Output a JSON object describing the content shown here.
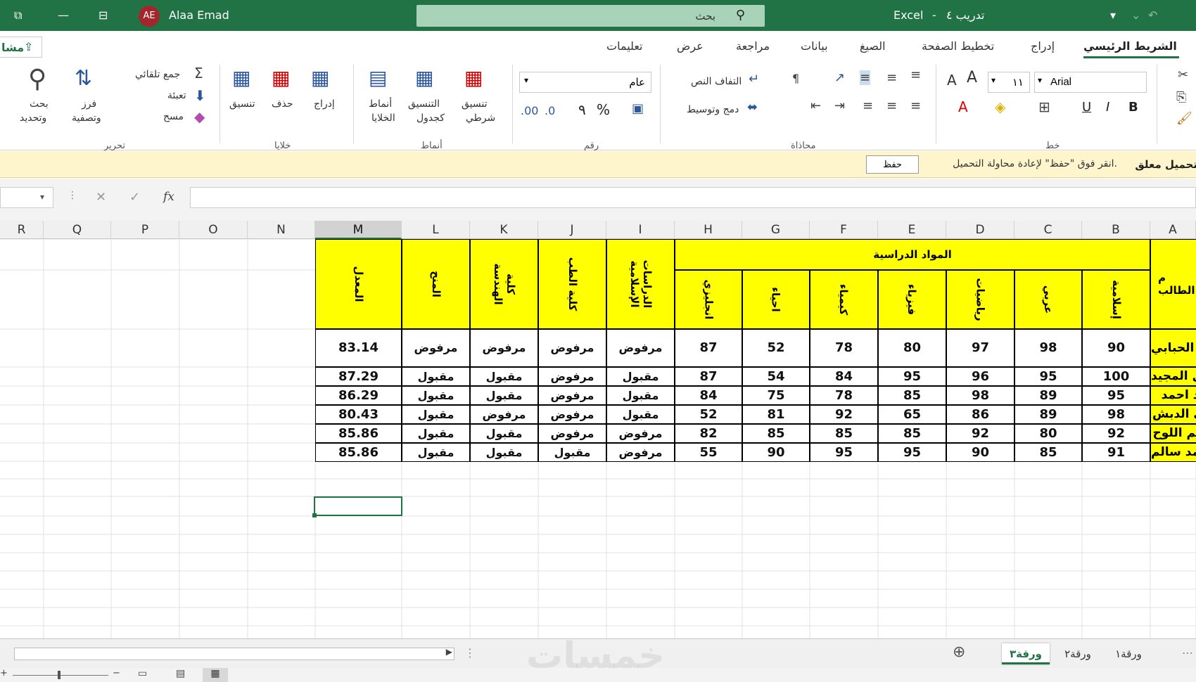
{
  "titlebar": {
    "user_initials": "AE",
    "user_name": "Alaa Emad",
    "search_label": "بحث",
    "app_name": "Excel",
    "doc_title": "تدريب ٤",
    "title_separator": "-"
  },
  "tabs": [
    "الشريط الرئيسي",
    "إدراج",
    "تخطيط الصفحة",
    "الصيغ",
    "بيانات",
    "مراجعة",
    "عرض",
    "تعليمات"
  ],
  "share_label": "مشا",
  "ribbon": {
    "font_name": "Arial",
    "font_size": "١١",
    "number_format": "عام",
    "wrap_text": "التفاف النص",
    "merge_center": "دمج وتوسيط",
    "cond_format": [
      "تنسيق",
      "شرطي"
    ],
    "format_table": [
      "التنسيق",
      "كجدول"
    ],
    "cell_styles": [
      "أنماط",
      "الخلايا"
    ],
    "insert": "إدراج",
    "delete": "حذف",
    "format": "تنسيق",
    "autosum": "جمع تلقائي",
    "fill": "تعبئة",
    "clear": "مسح",
    "sort_filter": [
      "فرز",
      "وتصفية"
    ],
    "find_select": [
      "بحث",
      "وتحديد"
    ],
    "groups": {
      "editing": "تحرير",
      "cells": "خلايا",
      "styles": "أنماط",
      "number": "رقم",
      "alignment": "محاذاة",
      "font": "خط"
    }
  },
  "notification": {
    "title": "تحميل معلق",
    "message": "انقر فوق \"حفظ\" لإعادة محاولة التحميل.",
    "button": "حفظ"
  },
  "formula_bar": {
    "fx": "fx",
    "cancel": "✕",
    "enter": "✓"
  },
  "columns": [
    "A",
    "B",
    "C",
    "D",
    "E",
    "F",
    "G",
    "H",
    "I",
    "J",
    "K",
    "L",
    "M",
    "N",
    "O",
    "P",
    "Q",
    "R"
  ],
  "sheet": {
    "name_header": "م الطالب",
    "subjects_header": "المواد الدراسية",
    "subjects": [
      "إسلامية",
      "عربي",
      "رياضيات",
      "فيزياء",
      "كيمياء",
      "احياء",
      "انجليزي"
    ],
    "extra_headers": [
      "الدراسات الإسلامية",
      "كلية الطب",
      "كلية الهندسة",
      "المنح",
      "المعدل"
    ],
    "rows": [
      {
        "name": "د الحبابي",
        "grades": [
          "90",
          "98",
          "97",
          "80",
          "78",
          "52",
          "87"
        ],
        "status": [
          "مرفوض",
          "مرفوض",
          "مرفوض",
          "مرفوض"
        ],
        "avg": "83.14"
      },
      {
        "name": "ال المجيد",
        "grades": [
          "100",
          "95",
          "96",
          "95",
          "84",
          "54",
          "87"
        ],
        "status": [
          "مقبول",
          "مرفوض",
          "مقبول",
          "مقبول"
        ],
        "avg": "87.29"
      },
      {
        "name": "يد احمد",
        "grades": [
          "95",
          "89",
          "98",
          "85",
          "78",
          "75",
          "84"
        ],
        "status": [
          "مقبول",
          "مرفوض",
          "مقبول",
          "مقبول"
        ],
        "avg": "86.29"
      },
      {
        "name": "ي الدبش",
        "grades": [
          "98",
          "89",
          "86",
          "65",
          "92",
          "81",
          "52"
        ],
        "status": [
          "مقبول",
          "مرفوض",
          "مرفوض",
          "مقبول"
        ],
        "avg": "80.43"
      },
      {
        "name": "الم اللوح",
        "grades": [
          "92",
          "80",
          "92",
          "85",
          "85",
          "85",
          "82"
        ],
        "status": [
          "مرفوض",
          "مرفوض",
          "مقبول",
          "مقبول"
        ],
        "avg": "85.86"
      },
      {
        "name": "حمد سالم",
        "grades": [
          "91",
          "85",
          "90",
          "95",
          "95",
          "90",
          "55"
        ],
        "status": [
          "مرفوض",
          "مقبول",
          "مقبول",
          "مقبول"
        ],
        "avg": "85.86"
      }
    ]
  },
  "sheet_tabs": [
    "ورقة١",
    "ورقة٢",
    "ورقة٣"
  ],
  "active_sheet": "ورقة٣",
  "watermark": "خمسات"
}
